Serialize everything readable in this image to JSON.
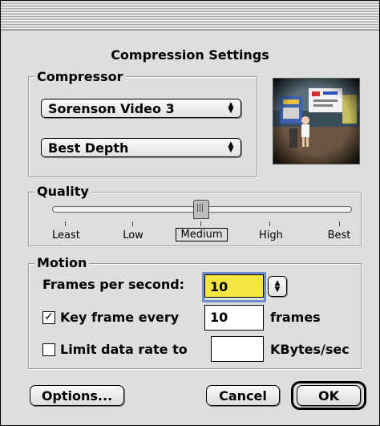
{
  "window": {
    "title": ""
  },
  "dialog": {
    "heading": "Compression Settings"
  },
  "compressor": {
    "label": "Compressor",
    "codec": {
      "value": "Sorenson Video 3"
    },
    "depth": {
      "value": "Best Depth"
    },
    "preview_icon": "video-preview-thumbnail"
  },
  "quality": {
    "label": "Quality",
    "ticks": [
      "Least",
      "Low",
      "Medium",
      "High",
      "Best"
    ],
    "selected": "Medium",
    "level": 0.5
  },
  "motion": {
    "label": "Motion",
    "fps": {
      "label": "Frames per second:",
      "value": "10"
    },
    "keyframe": {
      "label": "Key frame every",
      "value": "10",
      "unit": "frames",
      "checked": true,
      "check_glyph": "✓"
    },
    "datarate": {
      "label": "Limit data rate to",
      "value": "",
      "unit": "KBytes/sec",
      "checked": false
    }
  },
  "buttons": {
    "options": "Options...",
    "cancel": "Cancel",
    "ok": "OK"
  },
  "colors": {
    "focus_ring": "#6f8ec7",
    "field_highlight": "#f5e640"
  }
}
